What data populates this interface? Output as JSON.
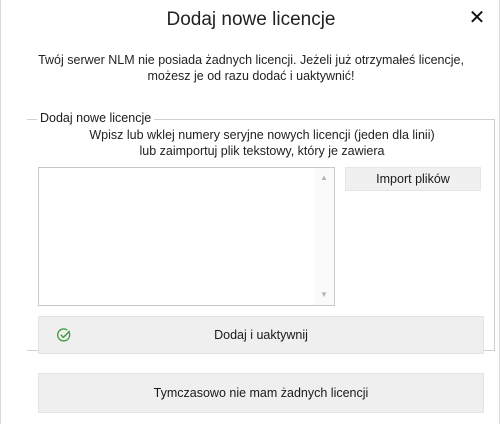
{
  "dialog": {
    "title": "Dodaj nowe licencje",
    "close_symbol": "✕",
    "description_line1": "Twój serwer NLM nie posiada żadnych licencji. Jeżeli już otrzymałeś licencje,",
    "description_line2": "możesz je od razu dodać i uaktywnić!"
  },
  "group": {
    "legend": "Dodaj nowe licencje",
    "hint_line1": "Wpisz lub wklej numery seryjne nowych licencji (jeden dla linii)",
    "hint_line2": "lub zaimportuj plik tekstowy, który je zawiera",
    "serials_value": "",
    "scroll_up_symbol": "▲",
    "scroll_down_symbol": "▼",
    "import_button_label": "Import plików",
    "activate_button_label": "Dodaj i uaktywnij",
    "activate_icon": "check-circle-icon"
  },
  "footer": {
    "no_license_button_label": "Tymczasowo nie mam żadnych licencji"
  },
  "colors": {
    "accent_green": "#3a9a3a",
    "button_bg": "#efefef",
    "border": "#cfcfcf"
  }
}
